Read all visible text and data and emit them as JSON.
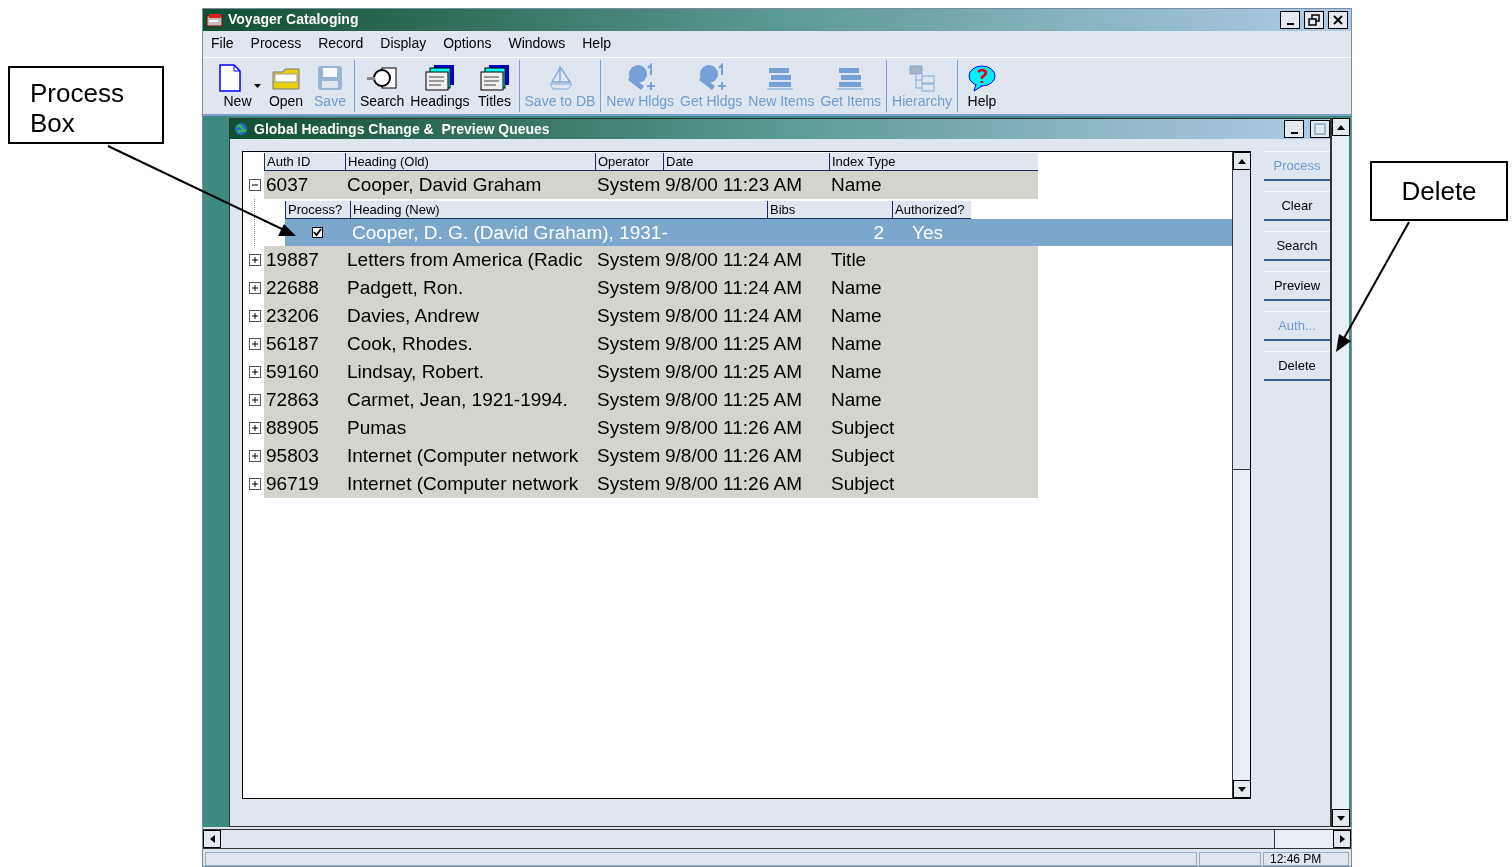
{
  "window": {
    "title": "Voyager Cataloging"
  },
  "menu": [
    "File",
    "Process",
    "Record",
    "Display",
    "Options",
    "Windows",
    "Help"
  ],
  "toolbar": [
    [
      {
        "label": "New",
        "kind": "page",
        "disabled": false,
        "dropdown": true
      },
      {
        "label": "Open",
        "kind": "folder",
        "disabled": false,
        "dropdown": false
      },
      {
        "label": "Save",
        "kind": "disk",
        "disabled": true,
        "dropdown": false
      }
    ],
    [
      {
        "label": "Search",
        "kind": "magnifier",
        "disabled": false,
        "dropdown": false
      },
      {
        "label": "Headings",
        "kind": "cards",
        "disabled": false,
        "dropdown": false
      },
      {
        "label": "Titles",
        "kind": "cards",
        "disabled": false,
        "dropdown": false
      }
    ],
    [
      {
        "label": "Save to DB",
        "kind": "ship",
        "disabled": true,
        "dropdown": false
      }
    ],
    [
      {
        "label": "New Hldgs",
        "kind": "books",
        "disabled": true,
        "dropdown": false
      },
      {
        "label": "Get Hldgs",
        "kind": "books",
        "disabled": true,
        "dropdown": false
      },
      {
        "label": "New Items",
        "kind": "stack",
        "disabled": true,
        "dropdown": false
      },
      {
        "label": "Get Items",
        "kind": "stack",
        "disabled": true,
        "dropdown": false
      }
    ],
    [
      {
        "label": "Hierarchy",
        "kind": "tree",
        "disabled": true,
        "dropdown": false
      }
    ],
    [
      {
        "label": "Help",
        "kind": "help",
        "disabled": false,
        "dropdown": false
      }
    ]
  ],
  "child_window": {
    "title": "Global Headings Change &  Preview Queues"
  },
  "table": {
    "columns": [
      "Auth ID",
      "Heading (Old)",
      "Operator",
      "Date",
      "Index Type"
    ],
    "sub_columns": [
      "Process?",
      "Heading (New)",
      "Bibs",
      "Authorized?"
    ],
    "rows": [
      {
        "auth_id": "6037",
        "heading": "Cooper, David Graham",
        "operator": "System",
        "date": "9/8/00 11:23 AM",
        "index_type": "Name",
        "expanded": true,
        "children": [
          {
            "process": true,
            "heading": "Cooper, D. G. (David Graham), 1931-",
            "bibs": "2",
            "authorized": "Yes",
            "selected": true
          }
        ]
      },
      {
        "auth_id": "19887",
        "heading": "Letters from America (Radic",
        "operator": "System",
        "date": "9/8/00 11:24 AM",
        "index_type": "Title",
        "expanded": false
      },
      {
        "auth_id": "22688",
        "heading": "Padgett, Ron.",
        "operator": "System",
        "date": "9/8/00 11:24 AM",
        "index_type": "Name",
        "expanded": false
      },
      {
        "auth_id": "23206",
        "heading": "Davies, Andrew",
        "operator": "System",
        "date": "9/8/00 11:24 AM",
        "index_type": "Name",
        "expanded": false
      },
      {
        "auth_id": "56187",
        "heading": "Cook, Rhodes.",
        "operator": "System",
        "date": "9/8/00 11:25 AM",
        "index_type": "Name",
        "expanded": false
      },
      {
        "auth_id": "59160",
        "heading": "Lindsay, Robert.",
        "operator": "System",
        "date": "9/8/00 11:25 AM",
        "index_type": "Name",
        "expanded": false
      },
      {
        "auth_id": "72863",
        "heading": "Carmet, Jean, 1921-1994.",
        "operator": "System",
        "date": "9/8/00 11:25 AM",
        "index_type": "Name",
        "expanded": false
      },
      {
        "auth_id": "88905",
        "heading": "Pumas",
        "operator": "System",
        "date": "9/8/00 11:26 AM",
        "index_type": "Subject",
        "expanded": false
      },
      {
        "auth_id": "95803",
        "heading": "Internet (Computer network",
        "operator": "System",
        "date": "9/8/00 11:26 AM",
        "index_type": "Subject",
        "expanded": false
      },
      {
        "auth_id": "96719",
        "heading": "Internet (Computer network",
        "operator": "System",
        "date": "9/8/00 11:26 AM",
        "index_type": "Subject",
        "expanded": false
      }
    ]
  },
  "side_buttons": [
    {
      "label": "Process",
      "disabled": true
    },
    {
      "label": "Clear",
      "disabled": false
    },
    {
      "label": "Search",
      "disabled": false
    },
    {
      "label": "Preview",
      "disabled": false
    },
    {
      "label": "Auth...",
      "disabled": true
    },
    {
      "label": "Delete",
      "disabled": false
    }
  ],
  "status_bar": {
    "time": "12:46 PM"
  },
  "annotations": [
    {
      "text": "Process Box"
    },
    {
      "text": "Delete"
    }
  ]
}
